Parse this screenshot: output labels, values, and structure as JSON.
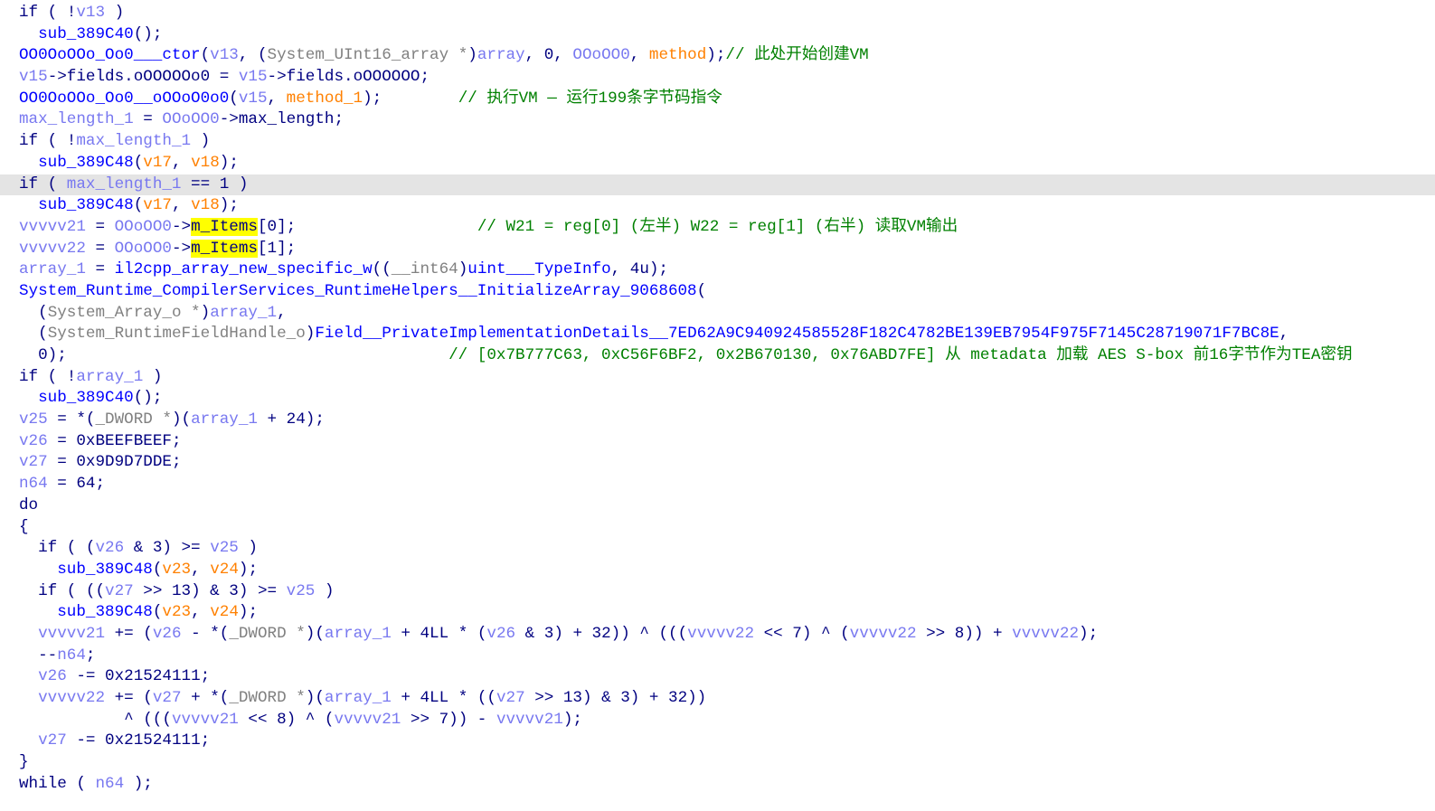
{
  "highlighted_line": 8,
  "colors": {
    "plain": "#000080",
    "function": "#0000ff",
    "variable": "#7878f0",
    "type": "#808080",
    "argument": "#ff8000",
    "comment": "#008000",
    "highlight": "#ffff00",
    "current_line": "#e4e4e4"
  },
  "lines": [
    [
      [
        "p",
        "if ( !"
      ],
      [
        "v",
        "v13"
      ],
      [
        "p",
        " )"
      ]
    ],
    [
      [
        "p",
        "  "
      ],
      [
        "f",
        "sub_389C40"
      ],
      [
        "p",
        "();"
      ]
    ],
    [
      [
        "f",
        "OO0OoOOo_Oo0___ctor"
      ],
      [
        "p",
        "("
      ],
      [
        "v",
        "v13"
      ],
      [
        "p",
        ", ("
      ],
      [
        "t",
        "System_UInt16_array *"
      ],
      [
        "p",
        ")"
      ],
      [
        "v",
        "array"
      ],
      [
        "p",
        ", 0, "
      ],
      [
        "v",
        "OOoOO0"
      ],
      [
        "p",
        ", "
      ],
      [
        "a",
        "method"
      ],
      [
        "p",
        ");"
      ],
      [
        "c",
        "// 此处开始创建VM"
      ]
    ],
    [
      [
        "v",
        "v15"
      ],
      [
        "p",
        "->fields.oOOOOOo0 = "
      ],
      [
        "v",
        "v15"
      ],
      [
        "p",
        "->fields.oOOOOOO;"
      ]
    ],
    [
      [
        "f",
        "OO0OoOOo_Oo0__oOOoO0o0"
      ],
      [
        "p",
        "("
      ],
      [
        "v",
        "v15"
      ],
      [
        "p",
        ", "
      ],
      [
        "a",
        "method_1"
      ],
      [
        "p",
        ");        "
      ],
      [
        "c",
        "// 执行VM — 运行199条字节码指令"
      ]
    ],
    [
      [
        "v",
        "max_length_1"
      ],
      [
        "p",
        " = "
      ],
      [
        "v",
        "OOoOO0"
      ],
      [
        "p",
        "->max_length;"
      ]
    ],
    [
      [
        "p",
        "if ( !"
      ],
      [
        "v",
        "max_length_1"
      ],
      [
        "p",
        " )"
      ]
    ],
    [
      [
        "p",
        "  "
      ],
      [
        "f",
        "sub_389C48"
      ],
      [
        "p",
        "("
      ],
      [
        "a",
        "v17"
      ],
      [
        "p",
        ", "
      ],
      [
        "a",
        "v18"
      ],
      [
        "p",
        ");"
      ]
    ],
    [
      [
        "p",
        "if ( "
      ],
      [
        "v",
        "max_length_1"
      ],
      [
        "p",
        " == 1 )"
      ]
    ],
    [
      [
        "p",
        "  "
      ],
      [
        "f",
        "sub_389C48"
      ],
      [
        "p",
        "("
      ],
      [
        "a",
        "v17"
      ],
      [
        "p",
        ", "
      ],
      [
        "a",
        "v18"
      ],
      [
        "p",
        ");"
      ]
    ],
    [
      [
        "v",
        "vvvvv21"
      ],
      [
        "p",
        " = "
      ],
      [
        "v",
        "OOoOO0"
      ],
      [
        "p",
        "->"
      ],
      [
        "h",
        "m_Items"
      ],
      [
        "p",
        "[0];                   "
      ],
      [
        "c",
        "// W21 = reg[0] (左半) W22 = reg[1] (右半) 读取VM输出"
      ]
    ],
    [
      [
        "v",
        "vvvvv22"
      ],
      [
        "p",
        " = "
      ],
      [
        "v",
        "OOoOO0"
      ],
      [
        "p",
        "->"
      ],
      [
        "h",
        "m_Items"
      ],
      [
        "p",
        "[1];"
      ]
    ],
    [
      [
        "v",
        "array_1"
      ],
      [
        "p",
        " = "
      ],
      [
        "f",
        "il2cpp_array_new_specific_w"
      ],
      [
        "p",
        "(("
      ],
      [
        "t",
        "__int64"
      ],
      [
        "p",
        ")"
      ],
      [
        "f",
        "uint___TypeInfo"
      ],
      [
        "p",
        ", 4u);"
      ]
    ],
    [
      [
        "f",
        "System_Runtime_CompilerServices_RuntimeHelpers__InitializeArray_9068608"
      ],
      [
        "p",
        "("
      ]
    ],
    [
      [
        "p",
        "  ("
      ],
      [
        "t",
        "System_Array_o *"
      ],
      [
        "p",
        ")"
      ],
      [
        "v",
        "array_1"
      ],
      [
        "p",
        ","
      ]
    ],
    [
      [
        "p",
        "  ("
      ],
      [
        "t",
        "System_RuntimeFieldHandle_o"
      ],
      [
        "p",
        ")"
      ],
      [
        "f",
        "Field__PrivateImplementationDetails__7ED62A9C940924585528F182C4782BE139EB7954F975F7145C28719071F7BC8E"
      ],
      [
        "p",
        ","
      ]
    ],
    [
      [
        "p",
        "  0);                                        "
      ],
      [
        "c",
        "// [0x7B777C63, 0xC56F6BF2, 0x2B670130, 0x76ABD7FE] 从 metadata 加载 AES S-box 前16字节作为TEA密钥"
      ]
    ],
    [
      [
        "p",
        "if ( !"
      ],
      [
        "v",
        "array_1"
      ],
      [
        "p",
        " )"
      ]
    ],
    [
      [
        "p",
        "  "
      ],
      [
        "f",
        "sub_389C40"
      ],
      [
        "p",
        "();"
      ]
    ],
    [
      [
        "v",
        "v25"
      ],
      [
        "p",
        " = *("
      ],
      [
        "t",
        "_DWORD *"
      ],
      [
        "p",
        ")("
      ],
      [
        "v",
        "array_1"
      ],
      [
        "p",
        " + 24);"
      ]
    ],
    [
      [
        "v",
        "v26"
      ],
      [
        "p",
        " = 0xBEEFBEEF;"
      ]
    ],
    [
      [
        "v",
        "v27"
      ],
      [
        "p",
        " = 0x9D9D7DDE;"
      ]
    ],
    [
      [
        "v",
        "n64"
      ],
      [
        "p",
        " = 64;"
      ]
    ],
    [
      [
        "p",
        "do"
      ]
    ],
    [
      [
        "p",
        "{"
      ]
    ],
    [
      [
        "p",
        "  if ( ("
      ],
      [
        "v",
        "v26"
      ],
      [
        "p",
        " & 3) >= "
      ],
      [
        "v",
        "v25"
      ],
      [
        "p",
        " )"
      ]
    ],
    [
      [
        "p",
        "    "
      ],
      [
        "f",
        "sub_389C48"
      ],
      [
        "p",
        "("
      ],
      [
        "a",
        "v23"
      ],
      [
        "p",
        ", "
      ],
      [
        "a",
        "v24"
      ],
      [
        "p",
        ");"
      ]
    ],
    [
      [
        "p",
        "  if ( (("
      ],
      [
        "v",
        "v27"
      ],
      [
        "p",
        " >> 13) & 3) >= "
      ],
      [
        "v",
        "v25"
      ],
      [
        "p",
        " )"
      ]
    ],
    [
      [
        "p",
        "    "
      ],
      [
        "f",
        "sub_389C48"
      ],
      [
        "p",
        "("
      ],
      [
        "a",
        "v23"
      ],
      [
        "p",
        ", "
      ],
      [
        "a",
        "v24"
      ],
      [
        "p",
        ");"
      ]
    ],
    [
      [
        "p",
        "  "
      ],
      [
        "v",
        "vvvvv21"
      ],
      [
        "p",
        " += ("
      ],
      [
        "v",
        "v26"
      ],
      [
        "p",
        " - *("
      ],
      [
        "t",
        "_DWORD *"
      ],
      [
        "p",
        ")("
      ],
      [
        "v",
        "array_1"
      ],
      [
        "p",
        " + 4LL * ("
      ],
      [
        "v",
        "v26"
      ],
      [
        "p",
        " & 3) + 32)) ^ ((("
      ],
      [
        "v",
        "vvvvv22"
      ],
      [
        "p",
        " << 7) ^ ("
      ],
      [
        "v",
        "vvvvv22"
      ],
      [
        "p",
        " >> 8)) + "
      ],
      [
        "v",
        "vvvvv22"
      ],
      [
        "p",
        ");"
      ]
    ],
    [
      [
        "p",
        "  --"
      ],
      [
        "v",
        "n64"
      ],
      [
        "p",
        ";"
      ]
    ],
    [
      [
        "p",
        "  "
      ],
      [
        "v",
        "v26"
      ],
      [
        "p",
        " -= 0x21524111;"
      ]
    ],
    [
      [
        "p",
        "  "
      ],
      [
        "v",
        "vvvvv22"
      ],
      [
        "p",
        " += ("
      ],
      [
        "v",
        "v27"
      ],
      [
        "p",
        " + *("
      ],
      [
        "t",
        "_DWORD *"
      ],
      [
        "p",
        ")("
      ],
      [
        "v",
        "array_1"
      ],
      [
        "p",
        " + 4LL * (("
      ],
      [
        "v",
        "v27"
      ],
      [
        "p",
        " >> 13) & 3) + 32))"
      ]
    ],
    [
      [
        "p",
        "           ^ ((("
      ],
      [
        "v",
        "vvvvv21"
      ],
      [
        "p",
        " << 8) ^ ("
      ],
      [
        "v",
        "vvvvv21"
      ],
      [
        "p",
        " >> 7)) - "
      ],
      [
        "v",
        "vvvvv21"
      ],
      [
        "p",
        ");"
      ]
    ],
    [
      [
        "p",
        "  "
      ],
      [
        "v",
        "v27"
      ],
      [
        "p",
        " -= 0x21524111;"
      ]
    ],
    [
      [
        "p",
        "}"
      ]
    ],
    [
      [
        "p",
        "while ( "
      ],
      [
        "v",
        "n64"
      ],
      [
        "p",
        " );"
      ]
    ]
  ]
}
